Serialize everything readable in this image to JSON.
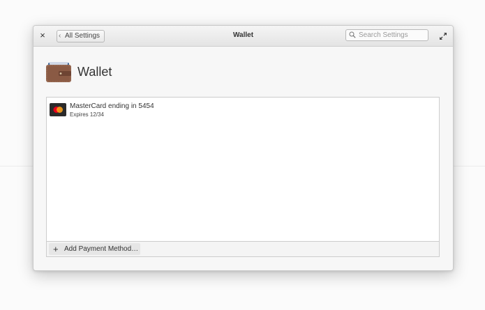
{
  "titlebar": {
    "close_label": "×",
    "back_label": "All Settings",
    "title": "Wallet",
    "search_placeholder": "Search Settings"
  },
  "header": {
    "title": "Wallet",
    "icon": "wallet-icon"
  },
  "payment_methods": [
    {
      "title": "MasterCard ending in 5454",
      "subtitle": "Expires 12/34",
      "icon": "mastercard-icon"
    }
  ],
  "actionbar": {
    "add_label": "Add Payment Method…",
    "add_icon": "+"
  },
  "colors": {
    "wallet_brown": "#8a5a44",
    "mastercard_red": "#eb001b",
    "mastercard_orange": "#f79e1b"
  }
}
